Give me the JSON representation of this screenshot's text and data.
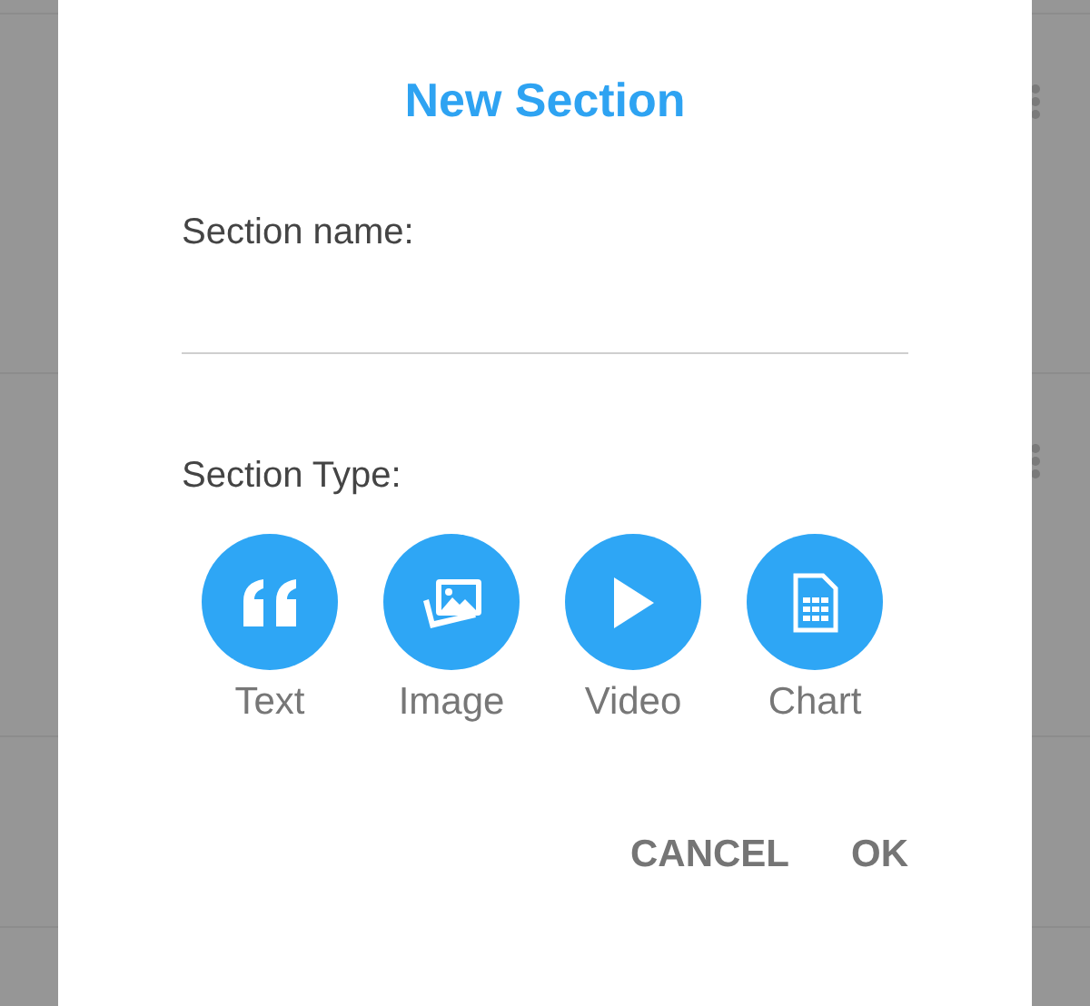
{
  "dialog": {
    "title": "New Section",
    "name_field": {
      "label": "Section name:"
    },
    "type_label": "Section Type:",
    "types": [
      {
        "kind": "text",
        "label": "Text"
      },
      {
        "kind": "image",
        "label": "Image"
      },
      {
        "kind": "video",
        "label": "Video"
      },
      {
        "kind": "chart",
        "label": "Chart"
      }
    ],
    "buttons": [
      "CANCEL",
      "OK"
    ]
  }
}
